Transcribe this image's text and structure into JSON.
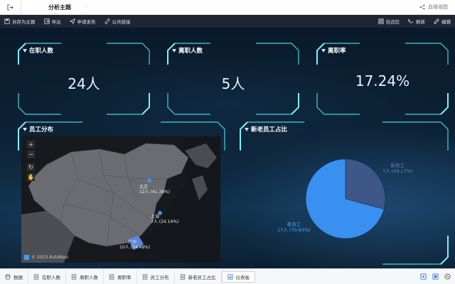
{
  "topbar": {
    "back_icon": "exit-icon",
    "title": "分析主题",
    "separator": "⁝",
    "hierarchy_label": "血缘视图"
  },
  "toolbar": {
    "save_as_theme": "另存为主题",
    "export": "导出",
    "apply_publish": "申请发布",
    "public_link": "公共链接",
    "adaptive": "自适应",
    "refresh": "刷新",
    "edit": "编辑"
  },
  "kpis": [
    {
      "title": "在职人数",
      "value": "24人"
    },
    {
      "title": "离职人数",
      "value": "5人"
    },
    {
      "title": "离职率",
      "value": "17.24%"
    }
  ],
  "map_card": {
    "title": "员工分布",
    "zoom_in": "+",
    "zoom_out": "−",
    "copyright": "© 2023 AutoNavi",
    "regions": [
      {
        "name": "北京",
        "value": "12人 (41.38%)"
      },
      {
        "name": "上海",
        "value": "7人 (24.14%)"
      },
      {
        "name": "广州",
        "value": "10人 (34.48%)"
      }
    ]
  },
  "pie_card": {
    "title": "新老员工占比"
  },
  "chart_data": {
    "type": "pie",
    "slices": [
      {
        "name": "新员工",
        "label": "7人 (29.17%)",
        "value": 7,
        "percent": 29.17,
        "color": "#3e5788"
      },
      {
        "name": "老员工",
        "label": "17人 (70.83%)",
        "value": 17,
        "percent": 70.83,
        "color": "#3a90f0"
      }
    ],
    "title": "新老员工占比",
    "legend": "none"
  },
  "tabs": [
    {
      "label": "数据",
      "icon": "database-icon"
    },
    {
      "label": "在职人数",
      "icon": "doc-icon"
    },
    {
      "label": "离职人数",
      "icon": "doc-icon"
    },
    {
      "label": "离职率",
      "icon": "doc-icon"
    },
    {
      "label": "员工分布",
      "icon": "doc-icon"
    },
    {
      "label": "新老员工占比",
      "icon": "doc-icon"
    },
    {
      "label": "仪表板",
      "icon": "dashboard-icon",
      "active": true
    }
  ],
  "colors": {
    "frame": "#4ad0e0",
    "toolbar_bg": "#1f2532",
    "canvas_bg": "#0c2236"
  }
}
